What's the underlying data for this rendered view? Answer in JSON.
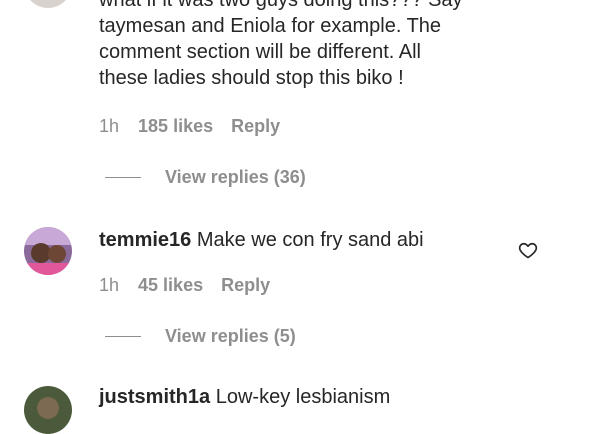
{
  "comments": [
    {
      "lines": [
        "what if it was two guys doing this??? Say",
        "taymesan and Eniola for example. The",
        "comment section will be different. All",
        "these ladies should stop this biko !"
      ],
      "time": "1h",
      "likes": "185 likes",
      "reply": "Reply",
      "view_replies": "View replies (36)"
    },
    {
      "username": "temmie16",
      "text": "Make we con fry sand abi",
      "time": "1h",
      "likes": "45 likes",
      "reply": "Reply",
      "view_replies": "View replies (5)",
      "like_icon": "heart-outline-icon"
    },
    {
      "username": "justsmith1a",
      "text": "Low-key lesbianism"
    }
  ],
  "colors": {
    "text": "#262626",
    "muted": "#8e8e8e",
    "background": "#ffffff"
  }
}
